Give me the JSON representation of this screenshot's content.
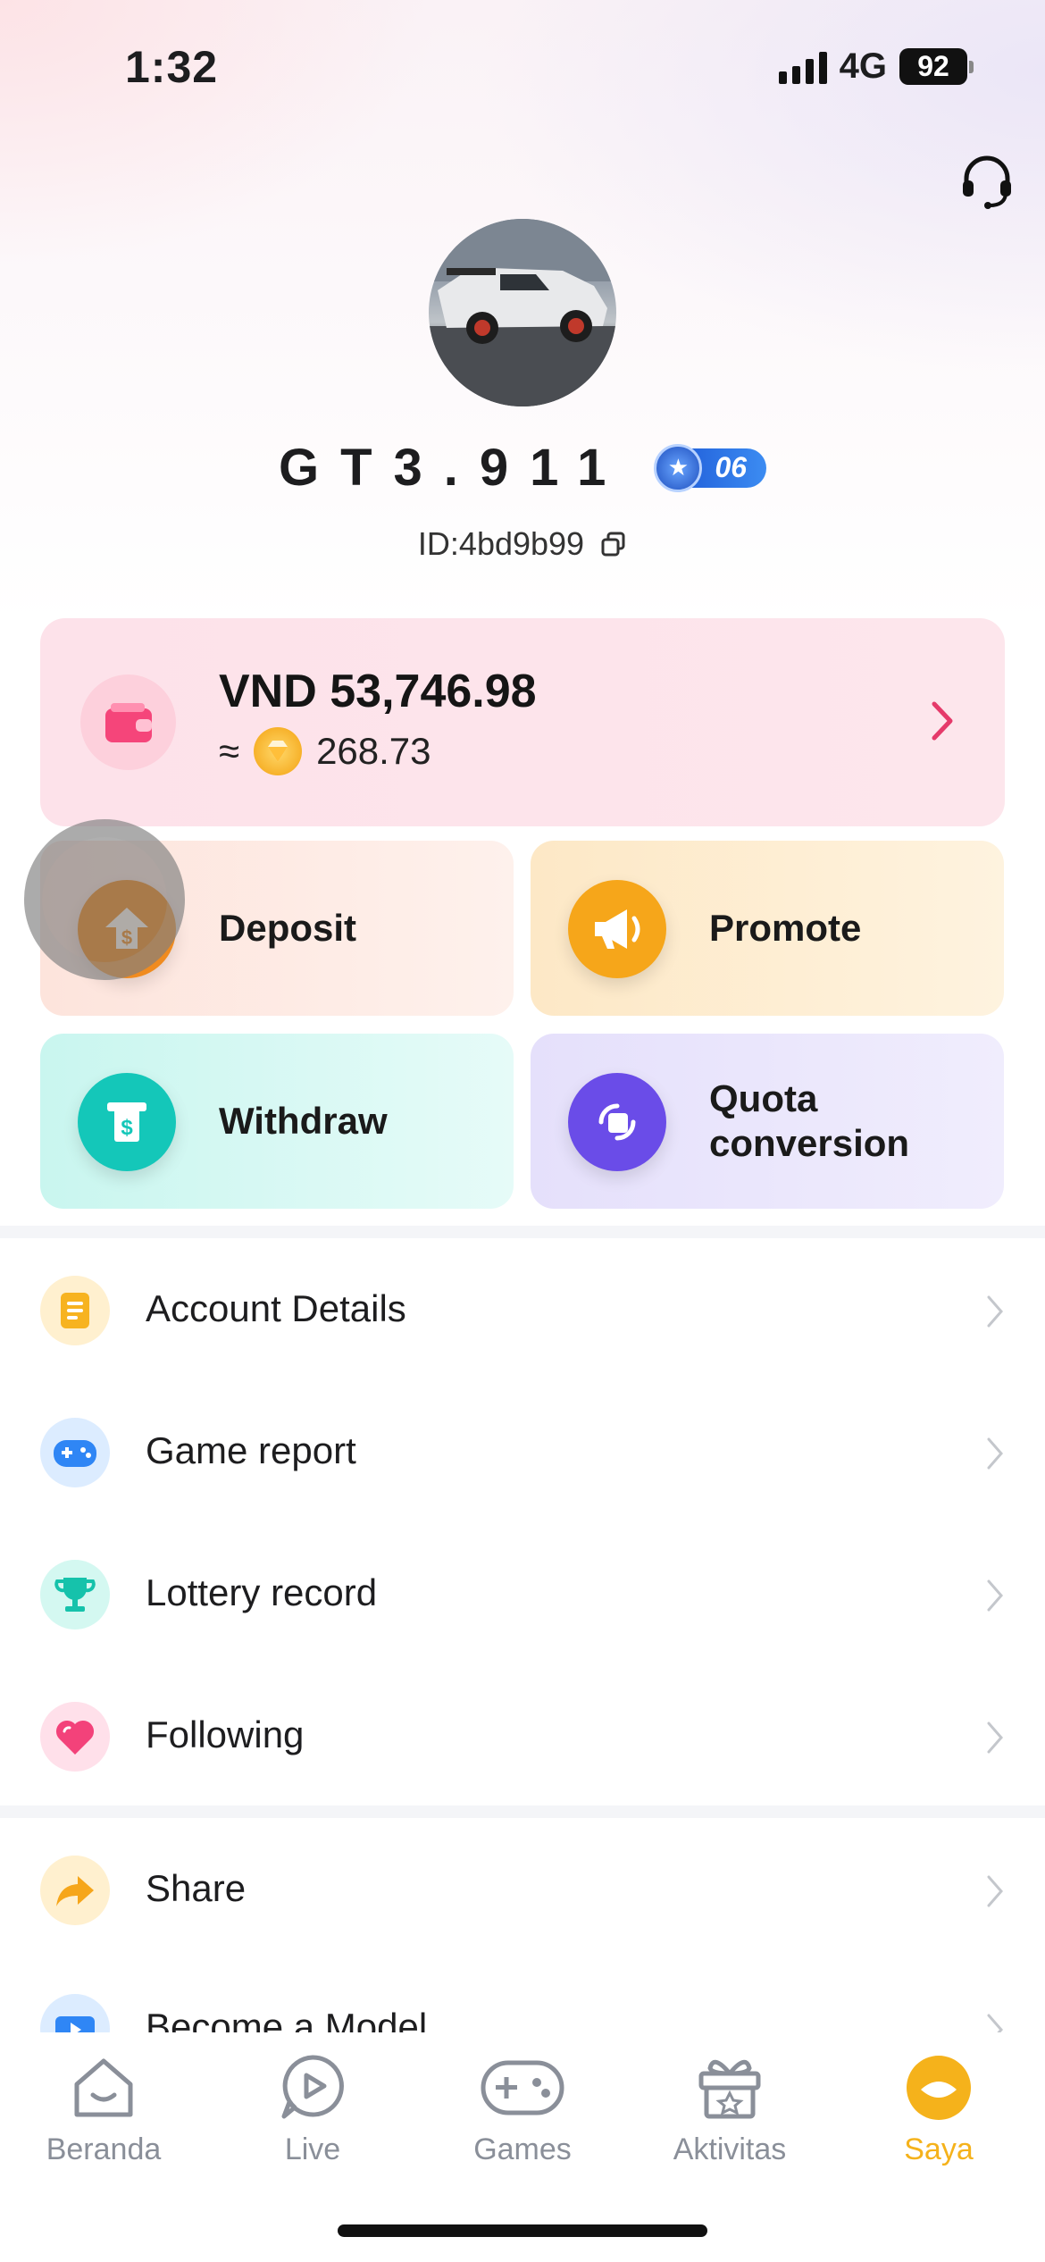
{
  "status_bar": {
    "time": "1:32",
    "network": "4G",
    "battery": "92"
  },
  "profile": {
    "username": "GT3.911",
    "level": "06",
    "user_id": "ID:4bd9b99"
  },
  "balance": {
    "amount": "VND 53,746.98",
    "approx_symbol": "≈",
    "coins": "268.73"
  },
  "actions": [
    {
      "label": "Deposit",
      "icon": "deposit-icon",
      "color": "#f08b1f"
    },
    {
      "label": "Promote",
      "icon": "megaphone-icon",
      "color": "#f6a61a"
    },
    {
      "label": "Withdraw",
      "icon": "withdraw-icon",
      "color": "#14c7b9"
    },
    {
      "label": "Quota conversion",
      "icon": "conversion-icon",
      "color": "#6a4ce8"
    }
  ],
  "menu": [
    {
      "label": "Account Details",
      "icon": "document-icon"
    },
    {
      "label": "Game report",
      "icon": "gamepad-icon"
    },
    {
      "label": "Lottery record",
      "icon": "trophy-icon"
    },
    {
      "label": "Following",
      "icon": "heart-icon"
    }
  ],
  "menu2": [
    {
      "label": "Share",
      "icon": "share-icon"
    },
    {
      "label": "Become a Model",
      "icon": "video-icon"
    }
  ],
  "tabs": [
    {
      "label": "Beranda",
      "icon": "home-icon"
    },
    {
      "label": "Live",
      "icon": "live-icon"
    },
    {
      "label": "Games",
      "icon": "gamepad-tab-icon"
    },
    {
      "label": "Aktivitas",
      "icon": "gift-icon"
    },
    {
      "label": "Saya",
      "icon": "profile-icon",
      "active": true
    }
  ],
  "colors": {
    "accent": "#f5b21b",
    "balance_arrow": "#e53a6a"
  }
}
